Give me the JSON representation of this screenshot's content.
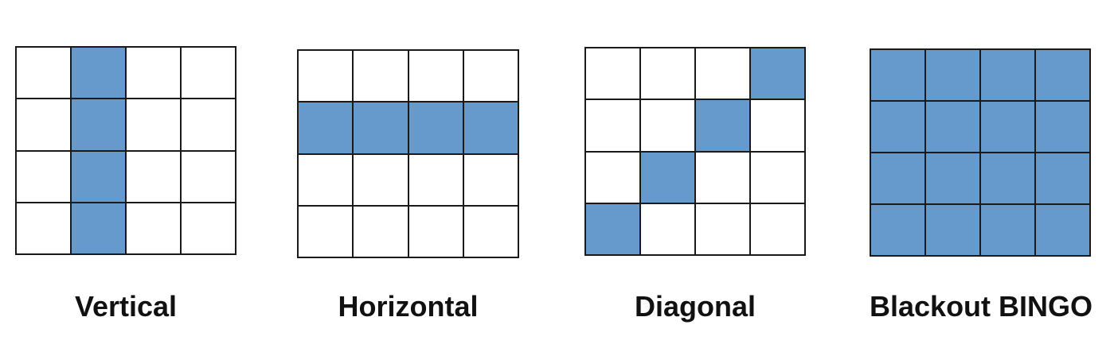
{
  "colors": {
    "filled": "#6699cc",
    "empty": "#ffffff",
    "line": "#1a1a1a"
  },
  "patterns": [
    {
      "label": "Vertical",
      "filled": [
        [
          0,
          1
        ],
        [
          1,
          1
        ],
        [
          2,
          1
        ],
        [
          3,
          1
        ]
      ]
    },
    {
      "label": "Horizontal",
      "filled": [
        [
          1,
          0
        ],
        [
          1,
          1
        ],
        [
          1,
          2
        ],
        [
          1,
          3
        ]
      ]
    },
    {
      "label": "Diagonal",
      "filled": [
        [
          0,
          3
        ],
        [
          1,
          2
        ],
        [
          2,
          1
        ],
        [
          3,
          0
        ]
      ]
    },
    {
      "label": "Blackout BINGO",
      "filled": "all"
    }
  ]
}
